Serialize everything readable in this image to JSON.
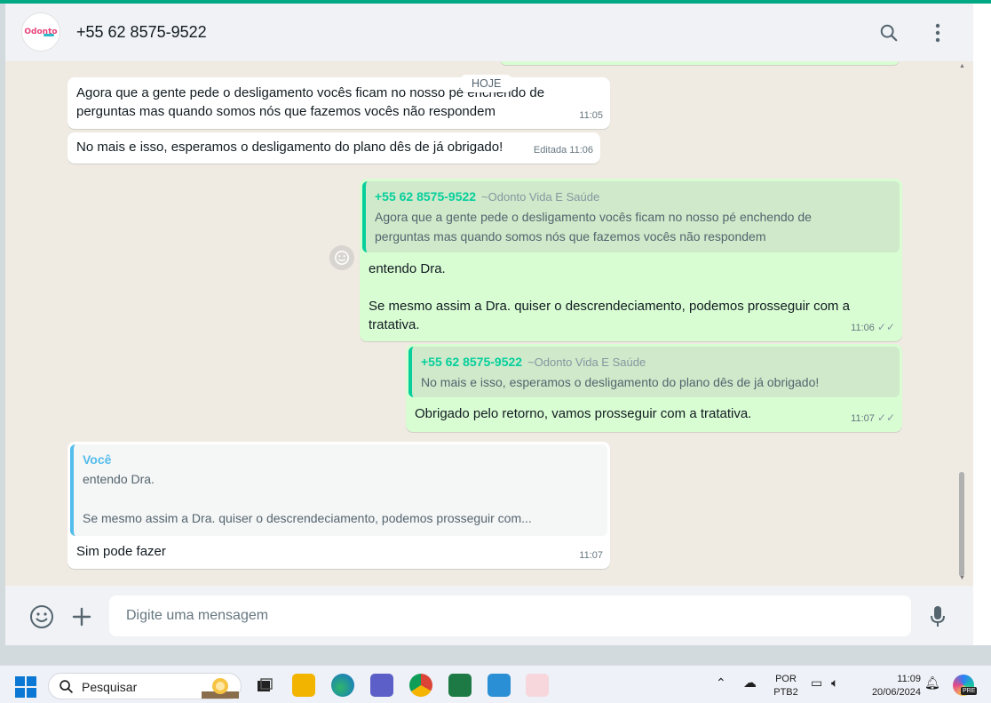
{
  "header": {
    "avatar_text": "Odonto",
    "contact_name": "+55 62 8575-9522"
  },
  "chat": {
    "date_chip": "HOJE",
    "messages": [
      {
        "text": "Agora que a gente pede o desligamento vocês ficam no nosso pé enchendo de perguntas mas quando somos nós que fazemos vocês não respondem",
        "time": "11:05"
      },
      {
        "text": "No mais e isso, esperamos o desligamento do plano dês de já obrigado!",
        "edited": "Editada",
        "time": "11:06"
      },
      {
        "quote_author": "+55 62 8575-9522",
        "quote_pushname": "~Odonto Vida E Saúde",
        "quote_text": "Agora que a gente pede o desligamento vocês ficam no nosso pé enchendo de perguntas mas quando somos nós que fazemos vocês não respondem",
        "text_line1": "entendo Dra.",
        "text_line2": "Se mesmo assim a Dra. quiser o descrendeciamento, podemos prosseguir com a tratativa.",
        "time": "11:06",
        "ticks": "✓✓"
      },
      {
        "quote_author": "+55 62 8575-9522",
        "quote_pushname": "~Odonto Vida E Saúde",
        "quote_text": "No mais e isso, esperamos o desligamento do plano dês de já obrigado!",
        "text": "Obrigado pelo retorno, vamos prosseguir com a tratativa.",
        "time": "11:07",
        "ticks": "✓✓"
      },
      {
        "quote_author": "Você",
        "quote_line1": "entendo Dra.",
        "quote_line2": "Se mesmo assim a Dra. quiser o descrendeciamento, podemos prosseguir com...",
        "text": "Sim pode fazer",
        "time": "11:07"
      }
    ]
  },
  "composer": {
    "placeholder": "Digite uma mensagem"
  },
  "taskbar": {
    "search_label": "Pesquisar",
    "lang_top": "POR",
    "lang_bottom": "PTB2",
    "time": "11:09",
    "date": "20/06/2024",
    "copilot_badge": "PRE"
  },
  "colors": {
    "accent": "#00a884",
    "incoming_bubble": "#ffffff",
    "outgoing_bubble": "#d9fdd3",
    "quote_bar": "#06cf9c",
    "you_quote": "#53bdeb"
  }
}
